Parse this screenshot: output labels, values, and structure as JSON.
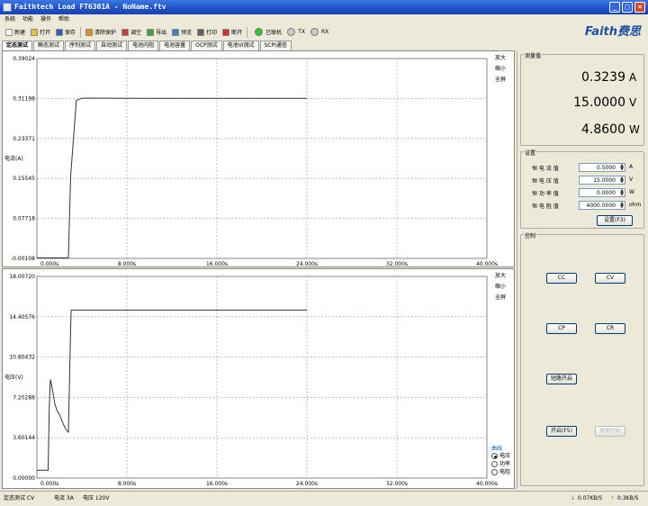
{
  "window": {
    "title": "Faithtech Load FT6301A - NoName.ftv",
    "min": "_",
    "max": "□",
    "close": "×"
  },
  "menu": [
    "系统",
    "功能",
    "操作",
    "帮助"
  ],
  "toolbar": {
    "items": [
      {
        "label": "新建",
        "icon": "new-file-icon",
        "color": "#ffffff"
      },
      {
        "label": "打开",
        "icon": "open-folder-icon",
        "color": "#e8c040"
      },
      {
        "label": "保存",
        "icon": "save-icon",
        "color": "#3060c0"
      },
      {
        "label": "清除保护",
        "icon": "clear-protect-icon",
        "color": "#e09020"
      },
      {
        "label": "调空",
        "icon": "tune-icon",
        "color": "#c04040"
      },
      {
        "label": "导出",
        "icon": "export-icon",
        "color": "#40a040"
      },
      {
        "label": "预览",
        "icon": "preview-icon",
        "color": "#4080c0"
      },
      {
        "label": "打印",
        "icon": "print-icon",
        "color": "#606060"
      },
      {
        "label": "断开",
        "icon": "disconnect-icon",
        "color": "#d03030"
      }
    ],
    "connected_label": "已联机",
    "tx": "TX",
    "rx": "RX"
  },
  "brand": "Faith费思",
  "tabs": [
    "定态测试",
    "瞬态测试",
    "序列测试",
    "自动测试",
    "电池内阻",
    "电池容量",
    "OCP测试",
    "电池VI测试",
    "SCPI通信"
  ],
  "chart_side_buttons": [
    "放大",
    "缩小",
    "全屏"
  ],
  "chart_data": [
    {
      "type": "line",
      "ylabel": "电流(A)",
      "ylim": [
        -0.00108,
        0.39024
      ],
      "yticks": [
        "0.39024",
        "0.31198",
        "0.23371",
        "0.15545",
        "0.07718",
        "-0.00108"
      ],
      "xticks": [
        "0.000s",
        "8.000s",
        "16.000s",
        "24.000s",
        "32.000s",
        "40.000s"
      ],
      "xlim": [
        0,
        40
      ],
      "grid": true,
      "series": [
        {
          "x": [
            0,
            0.8,
            1.5,
            2.0,
            2.3,
            2.5,
            2.8,
            3.0,
            3.5,
            4.0,
            5,
            10,
            15,
            20,
            24
          ],
          "y": [
            0,
            0,
            0,
            0,
            0,
            0,
            0,
            0.16,
            0.308,
            0.3125,
            0.3127,
            0.3124,
            0.3124,
            0.3124,
            0.3124
          ]
        }
      ]
    },
    {
      "type": "line",
      "ylabel": "电压(V)",
      "ylim": [
        0,
        18.0072
      ],
      "yticks": [
        "18.00720",
        "14.40576",
        "10.80432",
        "7.20288",
        "3.60144",
        "0.00000"
      ],
      "xticks": [
        "0.000s",
        "8.000s",
        "16.000s",
        "24.000s",
        "32.000s",
        "40.000s"
      ],
      "xlim": [
        0,
        40
      ],
      "grid": true,
      "series": [
        {
          "x": [
            0,
            1.0,
            1.1,
            1.2,
            1.4,
            1.6,
            1.8,
            2.0,
            2.2,
            2.4,
            2.6,
            2.8,
            3.0,
            3.05,
            3.2,
            24
          ],
          "y": [
            0.7,
            0.7,
            6.5,
            8.8,
            7.8,
            6.6,
            6.0,
            5.7,
            5.2,
            4.7,
            4.3,
            4.1,
            13.4,
            15.0,
            15.0,
            15.0
          ]
        }
      ]
    }
  ],
  "curve_group": {
    "title": "曲线",
    "options": [
      "电压",
      "功率",
      "电阻"
    ],
    "selected": 0
  },
  "measure": {
    "title": "测量值",
    "current": "0.3239",
    "current_unit": "A",
    "voltage": "15.0000",
    "voltage_unit": "V",
    "power": "4.8600",
    "power_unit": "W"
  },
  "settings": {
    "title": "设置",
    "rows": [
      {
        "label": "恒 电 流 值",
        "value": "0.5000",
        "unit": "A"
      },
      {
        "label": "恒 电 压 值",
        "value": "15.0000",
        "unit": "V"
      },
      {
        "label": "恒 功 率 值",
        "value": "0.0000",
        "unit": "W"
      },
      {
        "label": "恒 电 阻 值",
        "value": "4000.0000",
        "unit": "ohm"
      }
    ],
    "apply": "设置(F3)"
  },
  "control": {
    "title": "控制",
    "cc": "CC",
    "cv": "CV",
    "cp": "CP",
    "cr": "CR",
    "short": "短路开启",
    "on": "开启(F5)",
    "off": "关闭(F6)"
  },
  "status": {
    "mode": "定态测试 CV",
    "current": "电流 3A",
    "voltage": "电压 120V",
    "down": "0.07KB/S",
    "up": "0.3KB/S"
  }
}
